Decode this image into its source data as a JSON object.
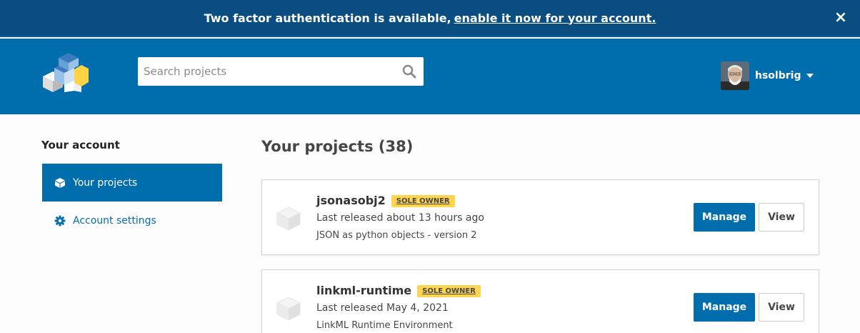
{
  "banner": {
    "text": "Two factor authentication is available,",
    "link": "enable it now for your account.",
    "close_icon": "×"
  },
  "header": {
    "search_placeholder": "Search projects",
    "username": "hsolbrig"
  },
  "sidebar": {
    "title": "Your account",
    "items": [
      {
        "label": "Your projects",
        "icon": "cube-icon",
        "active": true
      },
      {
        "label": "Account settings",
        "icon": "gear-icon",
        "active": false
      }
    ]
  },
  "main": {
    "title": "Your projects (38)",
    "projects": [
      {
        "name": "jsonasobj2",
        "badge": "SOLE OWNER",
        "released": "Last released about 13 hours ago",
        "description": "JSON as python objects - version 2",
        "manage": "Manage",
        "view": "View"
      },
      {
        "name": "linkml-runtime",
        "badge": "SOLE OWNER",
        "released": "Last released May 4, 2021",
        "description": "LinkML Runtime Environment",
        "manage": "Manage",
        "view": "View"
      }
    ]
  },
  "colors": {
    "banner": "#0a4d80",
    "header": "#006dad",
    "badge": "#ffd54f"
  }
}
